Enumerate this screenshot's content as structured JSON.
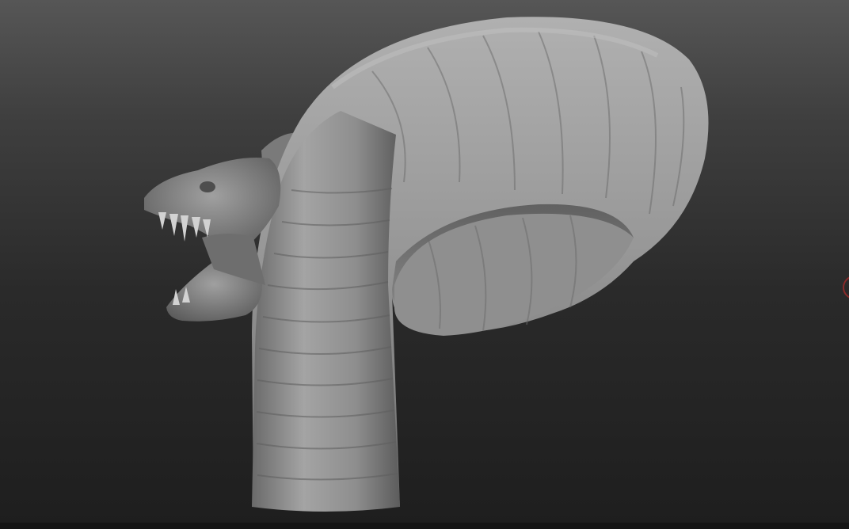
{
  "viewport": {
    "background_top": "#565656",
    "background_bottom": "#1e1e1e",
    "model_color": "#9a9a9a",
    "gizmo_color": "#8a2a2a"
  },
  "model": {
    "icon": "sculpt-mesh-icon"
  }
}
